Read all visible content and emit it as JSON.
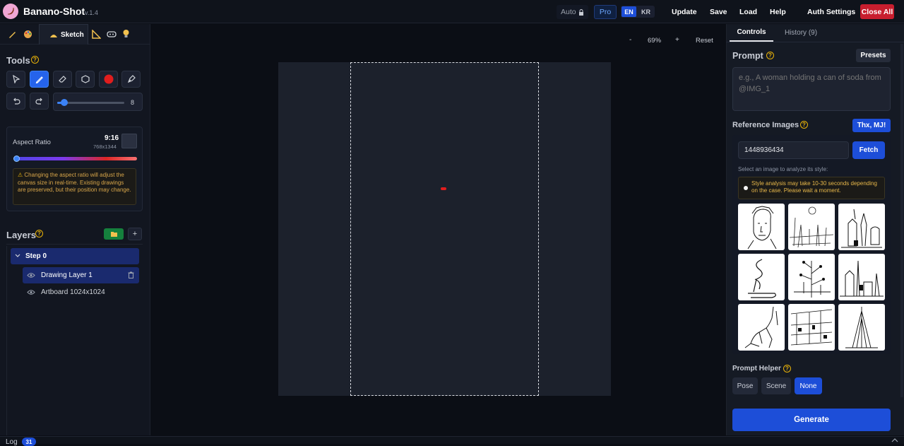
{
  "header": {
    "app_title": "Banano-Shot",
    "version": "v.1.4",
    "auto_label": "Auto",
    "pro_label": "Pro",
    "lang_en": "EN",
    "lang_kr": "KR",
    "menu": [
      "Update",
      "Save",
      "Load",
      "Help",
      "Auth Settings"
    ],
    "close_all": "Close All"
  },
  "left_tabs": {
    "active_label": "Sketch",
    "icons": [
      "pencil-icon",
      "palette-icon",
      "sketch-icon",
      "ruler-icon",
      "mask-icon",
      "lightbulb-icon"
    ]
  },
  "tools": {
    "title": "Tools",
    "help": "?",
    "items": [
      "select-icon",
      "pen-icon",
      "eraser-icon",
      "shape-icon",
      "color-swatch",
      "pen-nib-icon",
      "undo-icon",
      "redo-icon"
    ],
    "active_tool": "pen-icon",
    "brush_color": "#e11d1d",
    "brush_size": "8",
    "brush_size_fraction": 0.1
  },
  "aspect": {
    "label": "Aspect Ratio",
    "ratio": "9:16",
    "size": "768x1344",
    "slider_fraction": 0.02,
    "warning": "Changing the aspect ratio will adjust the canvas size in real-time. Existing drawings are preserved, but their position may change."
  },
  "layers": {
    "title": "Layers",
    "add": "+",
    "step": "Step 0",
    "items": [
      "Drawing Layer 1",
      "Artboard 1024x1024"
    ]
  },
  "canvas": {
    "zoom_out": "-",
    "zoom": "69%",
    "zoom_in": "+",
    "reset": "Reset"
  },
  "right_tabs": {
    "controls": "Controls",
    "history": "History (9)"
  },
  "prompt": {
    "title": "Prompt",
    "presets": "Presets",
    "placeholder": "e.g., A woman holding a can of soda from @IMG_1"
  },
  "reference": {
    "title": "Reference Images",
    "thx_button": "Thx, MJ!",
    "id_value": "1448936434",
    "fetch": "Fetch",
    "hint": "Select an image to analyze its style:",
    "warning": "Style analysis may take 10-30 seconds depending on the case. Please wait a moment."
  },
  "prompt_helper": {
    "title": "Prompt Helper",
    "options": [
      "Pose",
      "Scene",
      "None"
    ],
    "selected": "None"
  },
  "generate": "Generate",
  "log": {
    "label": "Log",
    "count": "31"
  },
  "colors": {
    "accent": "#1d4ed8",
    "danger": "#c81e2e",
    "warn": "#eab308"
  }
}
